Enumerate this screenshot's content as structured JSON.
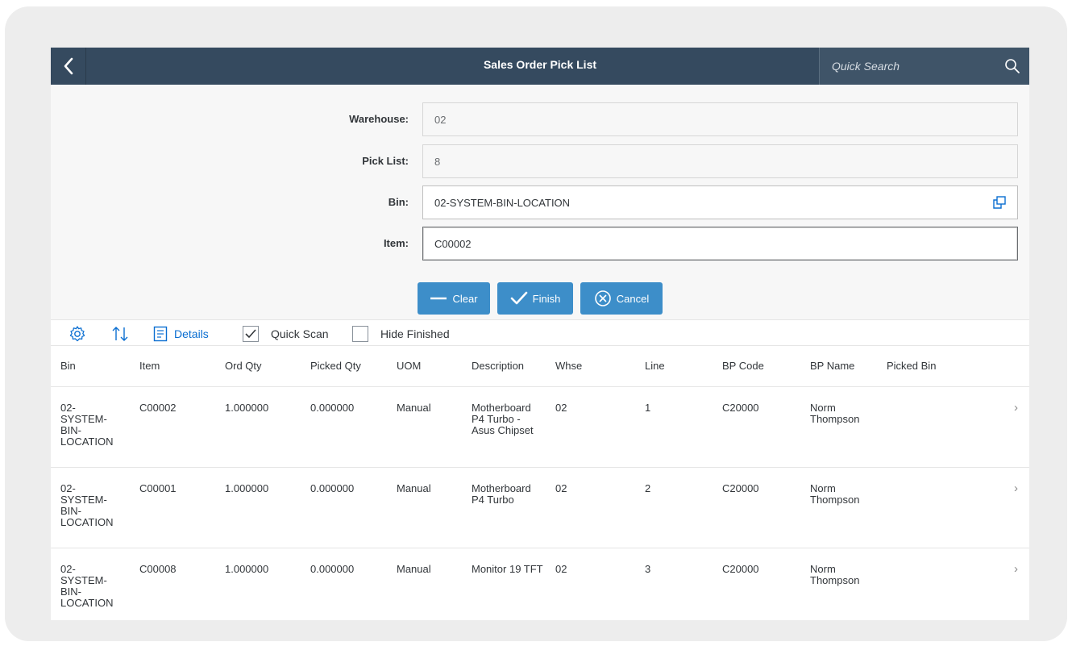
{
  "shell": {
    "title": "Sales Order Pick List",
    "search_placeholder": "Quick Search"
  },
  "form": {
    "warehouse": {
      "label": "Warehouse:",
      "value": "02"
    },
    "pick_list": {
      "label": "Pick List:",
      "value": "8"
    },
    "bin": {
      "label": "Bin:",
      "value": "02-SYSTEM-BIN-LOCATION"
    },
    "item": {
      "label": "Item:",
      "value": "C00002"
    }
  },
  "buttons": {
    "clear": "Clear",
    "finish": "Finish",
    "cancel": "Cancel"
  },
  "toolbar": {
    "details": "Details",
    "quick_scan": {
      "label": "Quick Scan",
      "checked": true
    },
    "hide_finished": {
      "label": "Hide Finished",
      "checked": false
    }
  },
  "table": {
    "columns": [
      "Bin",
      "Item",
      "Ord Qty",
      "Picked Qty",
      "UOM",
      "Description",
      "Whse",
      "Line",
      "BP Code",
      "BP Name",
      "Picked Bin"
    ],
    "rows": [
      {
        "bin": "02-SYSTEM-BIN-LOCATION",
        "item": "C00002",
        "ord_qty": "1.000000",
        "picked_qty": "0.000000",
        "uom": "Manual",
        "description": "Motherboard P4 Turbo - Asus Chipset",
        "whse": "02",
        "line": "1",
        "bp_code": "C20000",
        "bp_name": "Norm Thompson",
        "picked_bin": ""
      },
      {
        "bin": "02-SYSTEM-BIN-LOCATION",
        "item": "C00001",
        "ord_qty": "1.000000",
        "picked_qty": "0.000000",
        "uom": "Manual",
        "description": "Motherboard P4 Turbo",
        "whse": "02",
        "line": "2",
        "bp_code": "C20000",
        "bp_name": "Norm Thompson",
        "picked_bin": ""
      },
      {
        "bin": "02-SYSTEM-BIN-LOCATION",
        "item": "C00008",
        "ord_qty": "1.000000",
        "picked_qty": "0.000000",
        "uom": "Manual",
        "description": "Monitor 19 TFT",
        "whse": "02",
        "line": "3",
        "bp_code": "C20000",
        "bp_name": "Norm Thompson",
        "picked_bin": ""
      }
    ]
  },
  "icons": {
    "back": "chevron-left-icon",
    "search": "search-icon",
    "value_help": "value-help-icon",
    "settings": "gear-icon",
    "sort": "sort-icon",
    "details": "details-icon",
    "row_nav": "chevron-right-icon"
  },
  "colors": {
    "shell": "#354a5f",
    "button": "#3d8ec9",
    "link": "#0a6ed1"
  }
}
